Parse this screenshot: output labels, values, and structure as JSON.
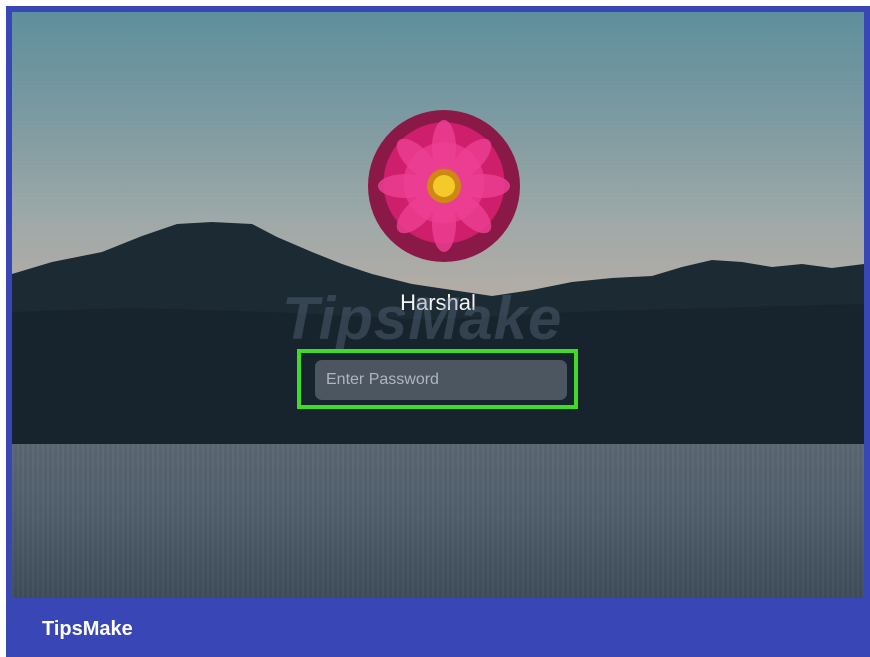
{
  "login": {
    "user_name": "Harshal",
    "password_placeholder": "Enter Password"
  },
  "watermark": "TipsMake",
  "footer": {
    "brand": "TipsMake"
  },
  "colors": {
    "frame": "#3946b5",
    "highlight": "#3cdc28"
  },
  "icons": {
    "avatar": "pink-flower-avatar"
  }
}
